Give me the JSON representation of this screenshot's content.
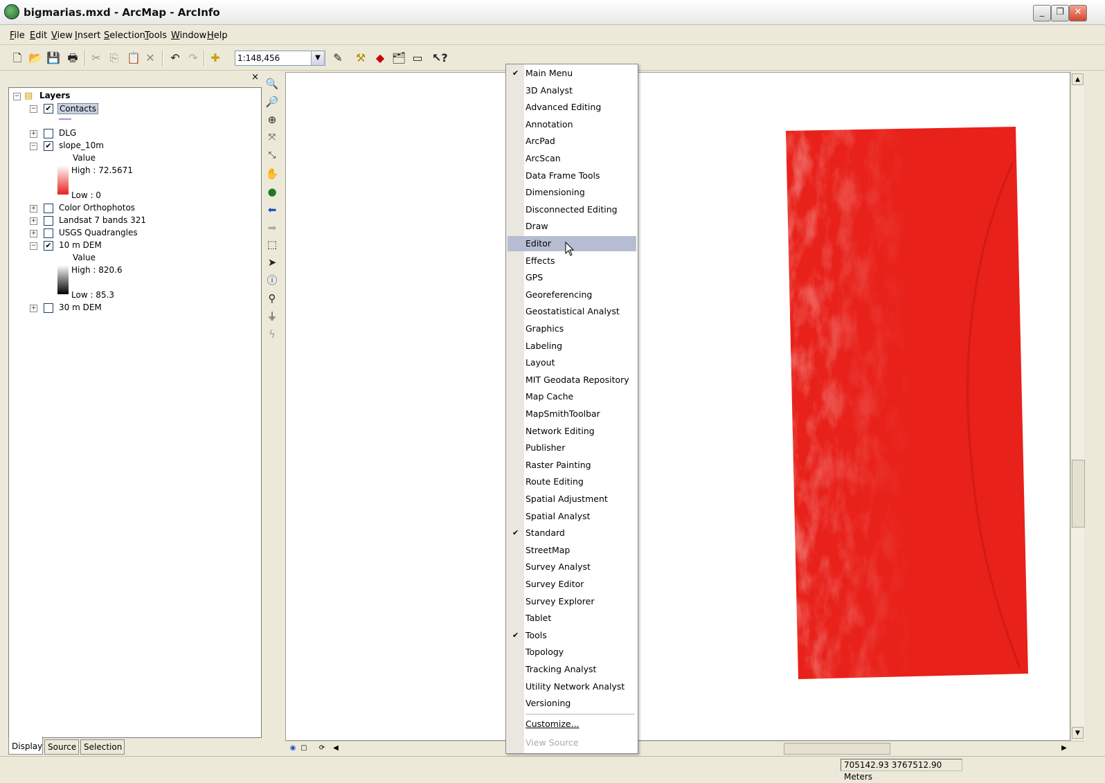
{
  "window": {
    "title": "bigmarias.mxd - ArcMap - ArcInfo",
    "minimize": "_",
    "restore": "❐",
    "close": "✕"
  },
  "menubar": [
    "File",
    "Edit",
    "View",
    "Insert",
    "Selection",
    "Tools",
    "Window",
    "Help"
  ],
  "toolbar": {
    "scale_value": "1:148,456",
    "icons": [
      "new-icon",
      "open-icon",
      "save-icon",
      "print-icon",
      "cut-icon",
      "copy-icon",
      "paste-icon",
      "delete-icon",
      "undo-icon",
      "redo-icon",
      "add-data-icon",
      "editor-icon",
      "arctoolbox-icon",
      "model-icon",
      "catalog-icon",
      "window-icon",
      "whats-this-icon"
    ]
  },
  "toc": {
    "close": "×",
    "root": "Layers",
    "layers": [
      {
        "name": "Contacts",
        "checked": true,
        "expanded": true
      },
      {
        "name": "DLG",
        "checked": false,
        "expanded": false
      },
      {
        "name": "slope_10m",
        "checked": true,
        "expanded": true,
        "legend_title": "Value",
        "high": "High : 72.5671",
        "low": "Low : 0"
      },
      {
        "name": "Color Orthophotos",
        "checked": false,
        "expanded": false
      },
      {
        "name": "Landsat 7 bands 321",
        "checked": false,
        "expanded": false
      },
      {
        "name": "USGS Quadrangles",
        "checked": false,
        "expanded": false
      },
      {
        "name": "10 m DEM",
        "checked": true,
        "expanded": true,
        "legend_title": "Value",
        "high": "High : 820.6",
        "low": "Low : 85.3"
      },
      {
        "name": "30 m DEM",
        "checked": false,
        "expanded": false
      }
    ],
    "tabs": [
      "Display",
      "Source",
      "Selection"
    ]
  },
  "context_menu": {
    "items": [
      {
        "label": "Main Menu",
        "checked": true
      },
      {
        "label": "3D Analyst"
      },
      {
        "label": "Advanced Editing"
      },
      {
        "label": "Annotation"
      },
      {
        "label": "ArcPad"
      },
      {
        "label": "ArcScan"
      },
      {
        "label": "Data Frame Tools"
      },
      {
        "label": "Dimensioning"
      },
      {
        "label": "Disconnected Editing"
      },
      {
        "label": "Draw"
      },
      {
        "label": "Editor",
        "highlighted": true
      },
      {
        "label": "Effects"
      },
      {
        "label": "GPS"
      },
      {
        "label": "Georeferencing"
      },
      {
        "label": "Geostatistical Analyst"
      },
      {
        "label": "Graphics"
      },
      {
        "label": "Labeling"
      },
      {
        "label": "Layout"
      },
      {
        "label": "MIT Geodata Repository"
      },
      {
        "label": "Map Cache"
      },
      {
        "label": "MapSmithToolbar"
      },
      {
        "label": "Network Editing"
      },
      {
        "label": "Publisher"
      },
      {
        "label": "Raster Painting"
      },
      {
        "label": "Route Editing"
      },
      {
        "label": "Spatial Adjustment"
      },
      {
        "label": "Spatial Analyst"
      },
      {
        "label": "Standard",
        "checked": true
      },
      {
        "label": "StreetMap"
      },
      {
        "label": "Survey Analyst"
      },
      {
        "label": "Survey Editor"
      },
      {
        "label": "Survey Explorer"
      },
      {
        "label": "Tablet"
      },
      {
        "label": "Tools",
        "checked": true
      },
      {
        "label": "Topology"
      },
      {
        "label": "Tracking Analyst"
      },
      {
        "label": "Utility Network Analyst"
      },
      {
        "label": "Versioning"
      }
    ],
    "customize": "Customize...",
    "view_source": "View Source"
  },
  "status": {
    "coordinates": "705142.93  3767512.90 Meters"
  },
  "colors": {
    "raster_red": "#e8211a",
    "menu_highlight": "#b6bdd2"
  }
}
